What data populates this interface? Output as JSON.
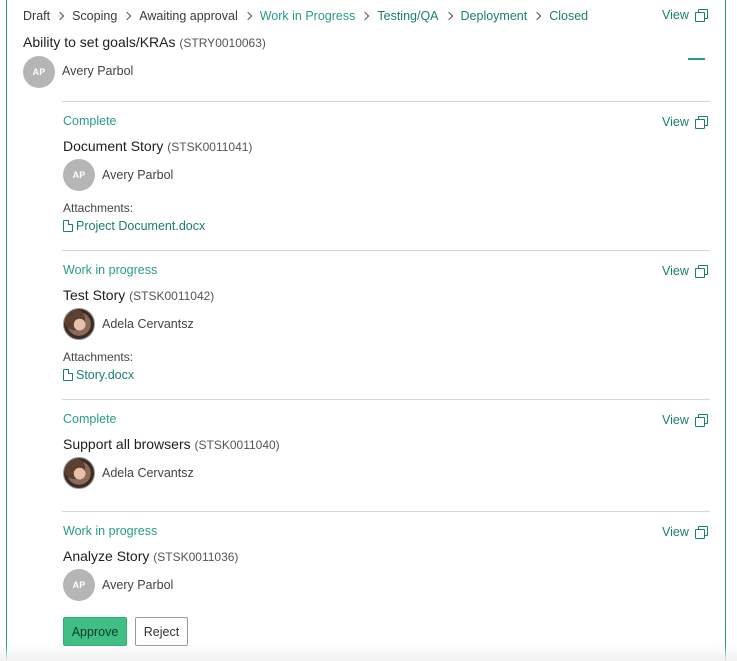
{
  "breadcrumb": [
    {
      "label": "Draft",
      "state": "default"
    },
    {
      "label": "Scoping",
      "state": "default"
    },
    {
      "label": "Awaiting approval",
      "state": "default"
    },
    {
      "label": "Work in Progress",
      "state": "active"
    },
    {
      "label": "Testing/QA",
      "state": "link"
    },
    {
      "label": "Deployment",
      "state": "link"
    },
    {
      "label": "Closed",
      "state": "link"
    }
  ],
  "view_label": "View",
  "story": {
    "title": "Ability to set goals/KRAs",
    "number": "(STRY0010063)",
    "assignee": {
      "initials": "AP",
      "name": "Avery Parbol"
    }
  },
  "tasks": [
    {
      "status": "Complete",
      "title": "Document Story",
      "number": "(STSK0011041)",
      "assignee": {
        "initials": "AP",
        "name": "Avery Parbol",
        "photo": false
      },
      "attachments_label": "Attachments:",
      "attachment": "Project Document.docx"
    },
    {
      "status": "Work in progress",
      "title": "Test Story",
      "number": "(STSK0011042)",
      "assignee": {
        "initials": "",
        "name": "Adela Cervantsz",
        "photo": true
      },
      "attachments_label": "Attachments:",
      "attachment": "Story.docx"
    },
    {
      "status": "Complete",
      "title": "Support all browsers",
      "number": "(STSK0011040)",
      "assignee": {
        "initials": "",
        "name": "Adela Cervantsz",
        "photo": true
      }
    },
    {
      "status": "Work in progress",
      "title": "Analyze Story",
      "number": "(STSK0011036)",
      "assignee": {
        "initials": "AP",
        "name": "Avery Parbol",
        "photo": false
      }
    }
  ],
  "actions": {
    "approve": "Approve",
    "reject": "Reject"
  },
  "icons": {
    "view": "copy-icon",
    "attachment": "document-icon",
    "collapse": "minus-icon",
    "separator": "chevron-right-icon"
  },
  "colors": {
    "accent": "#279c87",
    "link": "#1c7e6e",
    "approve_bg": "#3fbf84",
    "avatar_bg": "#b5b5b5"
  }
}
